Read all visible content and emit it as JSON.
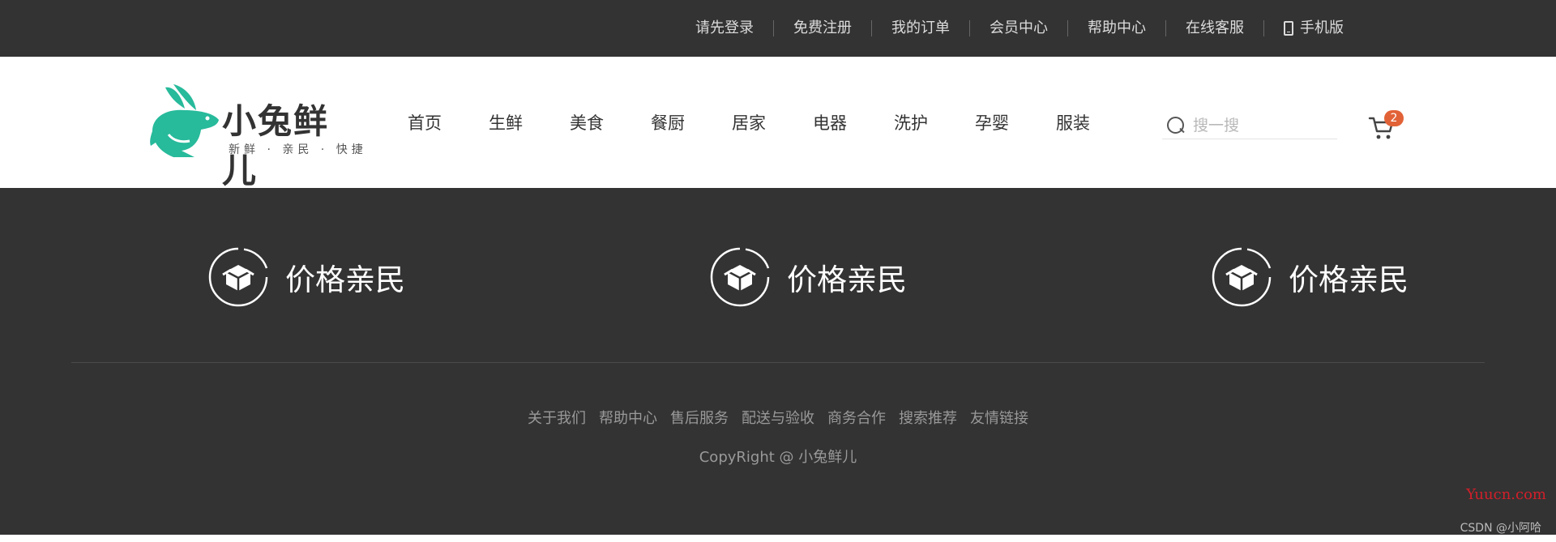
{
  "topnav": {
    "links": [
      {
        "label": "请先登录"
      },
      {
        "label": "免费注册"
      },
      {
        "label": "我的订单"
      },
      {
        "label": "会员中心"
      },
      {
        "label": "帮助中心"
      },
      {
        "label": "在线客服"
      },
      {
        "label": "手机版",
        "icon": "phone-icon"
      }
    ]
  },
  "header": {
    "logo": {
      "name": "小兔鲜儿",
      "slogan": "新鲜 · 亲民 · 快捷",
      "colors": {
        "rabbit": "#27ba9b",
        "text": "#333333"
      }
    },
    "nav": [
      "首页",
      "生鲜",
      "美食",
      "餐厨",
      "居家",
      "电器",
      "洗护",
      "孕婴",
      "服装"
    ],
    "search": {
      "placeholder": "搜一搜",
      "icon": "search-icon"
    },
    "cart": {
      "icon": "cart-icon",
      "count": "2",
      "badge_color": "#e26237"
    }
  },
  "footer": {
    "features": [
      {
        "label": "价格亲民",
        "icon": "package-box-icon"
      },
      {
        "label": "价格亲民",
        "icon": "package-box-icon"
      },
      {
        "label": "价格亲民",
        "icon": "package-box-icon"
      }
    ],
    "links": [
      "关于我们",
      "帮助中心",
      "售后服务",
      "配送与验收",
      "商务合作",
      "搜索推荐",
      "友情链接"
    ],
    "copyright": "CopyRight @ 小兔鲜儿",
    "background": "#333333"
  },
  "watermarks": {
    "site": "Yuucn.com",
    "csdn": "CSDN @小阿哈"
  }
}
